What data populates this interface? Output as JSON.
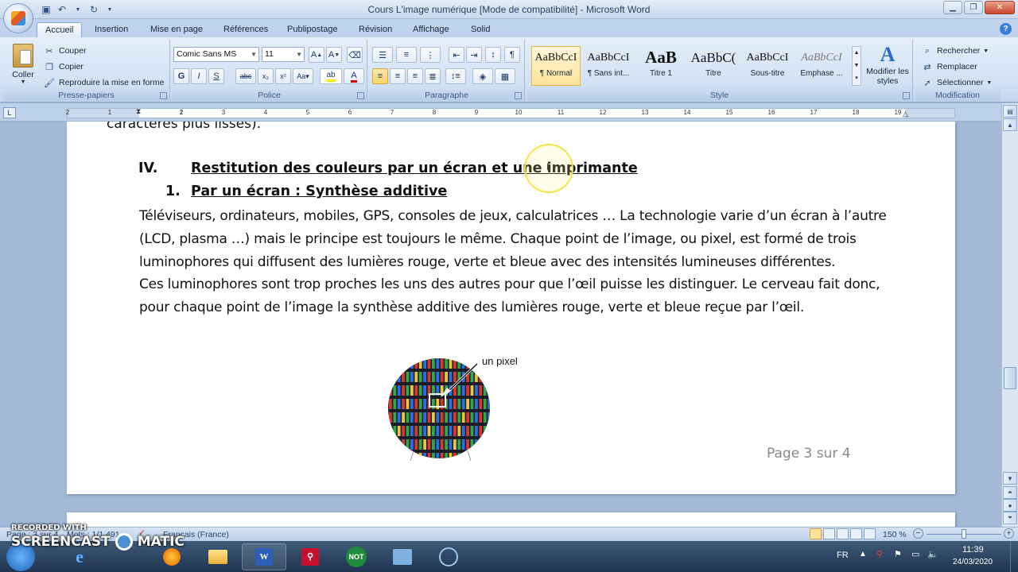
{
  "window": {
    "title": "Cours L'image numérique [Mode de compatibilité] - Microsoft Word"
  },
  "quick_access": {
    "save_icon": "save-icon",
    "undo_icon": "undo-icon",
    "redo_icon": "redo-icon"
  },
  "tabs": [
    "Accueil",
    "Insertion",
    "Mise en page",
    "Références",
    "Publipostage",
    "Révision",
    "Affichage",
    "Solid"
  ],
  "active_tab": "Accueil",
  "ribbon": {
    "clipboard": {
      "paste": "Coller",
      "cut": "Couper",
      "copy": "Copier",
      "format_painter": "Reproduire la mise en forme",
      "label": "Presse-papiers"
    },
    "font": {
      "family": "Comic Sans MS",
      "size": "11",
      "label": "Police",
      "bold": "G",
      "italic": "I",
      "underline": "S"
    },
    "paragraph": {
      "label": "Paragraphe"
    },
    "styles": {
      "label": "Style",
      "items": [
        {
          "sample": "AaBbCcI",
          "name": "¶ Normal"
        },
        {
          "sample": "AaBbCcI",
          "name": "¶ Sans int..."
        },
        {
          "sample": "AaB",
          "name": "Titre 1"
        },
        {
          "sample": "AaBbC(",
          "name": "Titre"
        },
        {
          "sample": "AaBbCcI",
          "name": "Sous-titre"
        },
        {
          "sample": "AaBbCcI",
          "name": "Emphase ..."
        }
      ],
      "modify": "Modifier les styles"
    },
    "editing": {
      "find": "Rechercher",
      "replace": "Remplacer",
      "select": "Sélectionner",
      "label": "Modification"
    }
  },
  "ruler": {
    "ticks": [
      "2",
      "1",
      "1",
      "2",
      "3",
      "4",
      "5",
      "6",
      "7",
      "8",
      "9",
      "10",
      "11",
      "12",
      "13",
      "14",
      "15",
      "16",
      "17",
      "18",
      "19"
    ]
  },
  "document": {
    "cut_line": "caractères plus lisses).",
    "section_num": "IV.",
    "section_title": "Restitution des couleurs par un écran et une imprimante",
    "sub_num": "1.",
    "sub_title": "Par un écran : Synthèse additive",
    "paragraph1": "Téléviseurs, ordinateurs, mobiles, GPS, consoles de jeux, calculatrices  … La technologie varie d’un écran à l’autre (LCD, plasma …) mais le principe est toujours le même. Chaque point de l’image, ou pixel, est formé de trois luminophores qui diffusent des lumières rouge, verte et bleue avec des intensités lumineuses différentes.",
    "paragraph2": "Ces luminophores sont trop proches les uns des autres pour que l’œil puisse les distinguer. Le cerveau fait donc, pour chaque point de l’image la synthèse additive des lumières rouge, verte et bleue reçue par l’œil.",
    "figure_label": "un pixel",
    "page_footer": "Page 3 sur 4"
  },
  "statusbar": {
    "page": "Page : 3 sur 4",
    "words": "Mots : 1/1 491",
    "language": "Français (France)",
    "zoom": "150 %"
  },
  "taskbar": {
    "apps": [
      "ie-icon",
      "firefox-icon",
      "explorer-icon",
      "word-icon",
      "acrobat-icon",
      "notebook-icon",
      "network-icon",
      "media-icon"
    ],
    "notebook_label": "NOT",
    "language": "FR",
    "time": "11:39",
    "date": "24/03/2020"
  },
  "watermark": {
    "line1": "RECORDED WITH",
    "line2a": "SCREENCAST",
    "line2b": "MATIC"
  },
  "colors": {
    "accent": "#2b579a",
    "ribbon_bg": "#d3e2f3",
    "highlight_ring": "#f5e44a"
  }
}
